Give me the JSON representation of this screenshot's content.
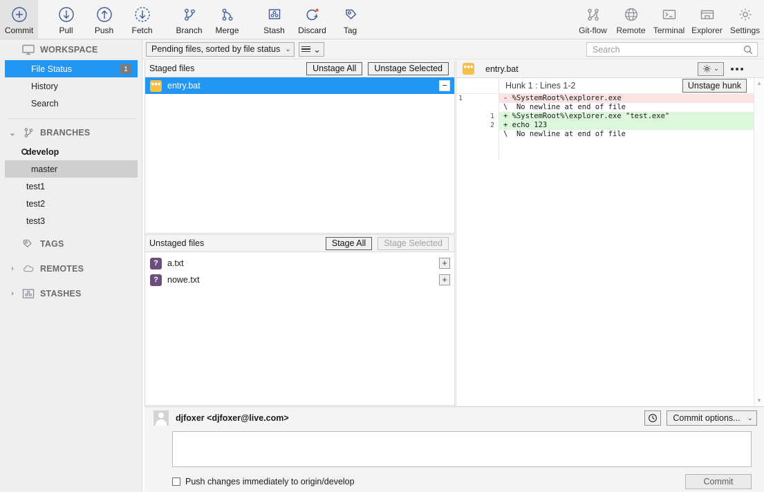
{
  "toolbar": {
    "left_buttons": [
      {
        "label": "Commit",
        "icon": "plus-circle-icon",
        "active": true
      },
      {
        "label": "Pull",
        "icon": "arrow-down-circle-icon",
        "active": false
      },
      {
        "label": "Push",
        "icon": "arrow-up-circle-icon",
        "active": false
      },
      {
        "label": "Fetch",
        "icon": "arrow-down-dashed-circle-icon",
        "active": false
      },
      {
        "label": "Branch",
        "icon": "branch-icon",
        "active": false
      },
      {
        "label": "Merge",
        "icon": "merge-icon",
        "active": false
      },
      {
        "label": "Stash",
        "icon": "stash-icon",
        "active": false
      },
      {
        "label": "Discard",
        "icon": "discard-refresh-icon",
        "active": false
      },
      {
        "label": "Tag",
        "icon": "tag-icon",
        "active": false
      }
    ],
    "right_buttons": [
      {
        "label": "Git-flow",
        "icon": "gitflow-icon"
      },
      {
        "label": "Remote",
        "icon": "globe-icon"
      },
      {
        "label": "Terminal",
        "icon": "terminal-icon"
      },
      {
        "label": "Explorer",
        "icon": "folder-explorer-icon"
      },
      {
        "label": "Settings",
        "icon": "gear-icon"
      }
    ]
  },
  "sidebar": {
    "workspace": {
      "label": "WORKSPACE",
      "icon": "monitor-icon",
      "items": [
        {
          "label": "File Status",
          "badge": "1",
          "selected": true
        },
        {
          "label": "History",
          "badge": "",
          "selected": false
        },
        {
          "label": "Search",
          "badge": "",
          "selected": false
        }
      ]
    },
    "branches": {
      "label": "BRANCHES",
      "icon": "branch-icon",
      "caret": "⌄",
      "expanded": true,
      "items": [
        {
          "label": "develop",
          "current": true,
          "selected": false
        },
        {
          "label": "master",
          "current": false,
          "selected": true
        },
        {
          "label": "test1",
          "current": false,
          "selected": false
        },
        {
          "label": "test2",
          "current": false,
          "selected": false
        },
        {
          "label": "test3",
          "current": false,
          "selected": false
        }
      ]
    },
    "tags": {
      "label": "TAGS",
      "icon": "tag-icon",
      "caret": ""
    },
    "remotes": {
      "label": "REMOTES",
      "icon": "cloud-icon",
      "caret": "›"
    },
    "stashes": {
      "label": "STASHES",
      "icon": "stash-icon",
      "caret": "›"
    }
  },
  "midbar": {
    "filter_label": "Pending files, sorted by file status",
    "filter_caret": "⌄",
    "view_caret": "⌄",
    "view_icon": "list-view-icon"
  },
  "search": {
    "placeholder": "Search",
    "value": "",
    "icon": "search-icon"
  },
  "staged": {
    "title": "Staged files",
    "unstage_all_label": "Unstage All",
    "unstage_selected_label": "Unstage Selected",
    "files": [
      {
        "name": "entry.bat",
        "status_icon": "modified-file-icon",
        "status_glyph": "•••",
        "selected": true,
        "action_glyph": "−",
        "action_name": "unstage-file-button"
      }
    ]
  },
  "unstaged": {
    "title": "Unstaged files",
    "stage_all_label": "Stage All",
    "stage_selected_label": "Stage Selected",
    "files": [
      {
        "name": "a.txt",
        "status_icon": "untracked-file-icon",
        "status_glyph": "?",
        "selected": false,
        "action_glyph": "+",
        "action_name": "stage-file-button"
      },
      {
        "name": "nowe.txt",
        "status_icon": "untracked-file-icon",
        "status_glyph": "?",
        "selected": false,
        "action_glyph": "+",
        "action_name": "stage-file-button"
      }
    ]
  },
  "diff": {
    "filename": "entry.bat",
    "file_icon": "modified-file-icon",
    "file_glyph": "•••",
    "gear_icon": "gear-icon",
    "gear_caret": "⌄",
    "more_icon": "more-dots-icon",
    "hunk_title": "Hunk 1 : Lines 1-2",
    "unstage_hunk_label": "Unstage hunk",
    "lines": [
      {
        "old": "1",
        "new": "",
        "kind": "del",
        "text": "- %SystemRoot%\\explorer.exe"
      },
      {
        "old": "",
        "new": "",
        "kind": "ctx",
        "text": "\\  No newline at end of file"
      },
      {
        "old": "",
        "new": "1",
        "kind": "add",
        "text": "+ %SystemRoot%\\explorer.exe \"test.exe\""
      },
      {
        "old": "",
        "new": "2",
        "kind": "add",
        "text": "+ echo 123"
      },
      {
        "old": "",
        "new": "",
        "kind": "ctx",
        "text": "\\  No newline at end of file"
      }
    ],
    "scroll_up_glyph": "▲",
    "scroll_down_glyph": "▼"
  },
  "commit": {
    "author": "djfoxer <djfoxer@live.com>",
    "avatar_icon": "avatar-icon",
    "history_icon": "clock-icon",
    "options_label": "Commit options...",
    "options_caret": "⌄",
    "message_value": "",
    "message_placeholder": "",
    "push_checkbox_label": "Push changes immediately to origin/develop",
    "push_checked": false,
    "commit_button_label": "Commit"
  },
  "colors": {
    "accent_blue": "#2196f3",
    "icon_blue": "#3c5a99",
    "diff_add": "#ddf7dd",
    "diff_del": "#fbe3e4",
    "modified": "#f7bf45",
    "untracked": "#6b4e7d"
  }
}
